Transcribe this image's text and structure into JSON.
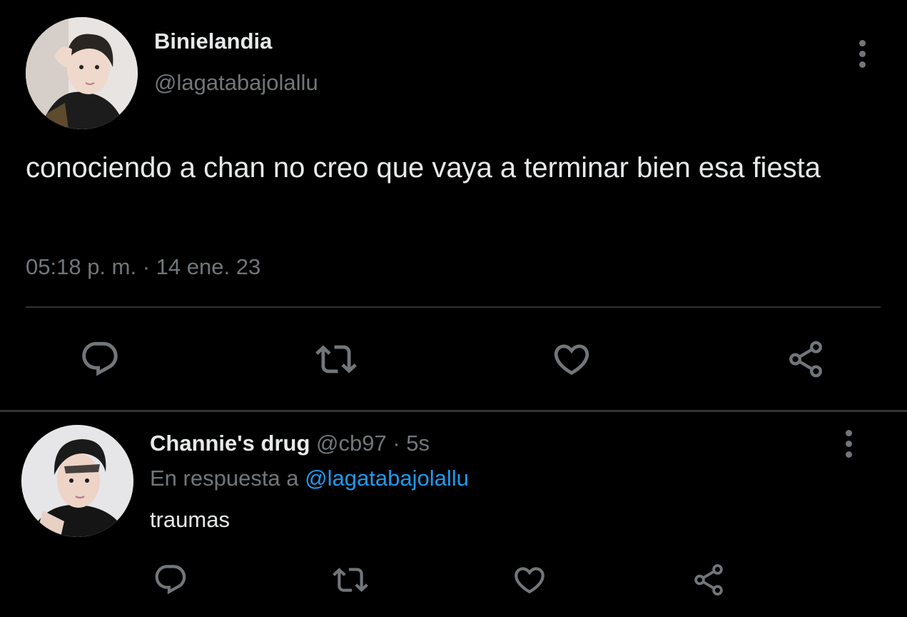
{
  "main_tweet": {
    "author_name": "Binielandia",
    "author_handle": "@lagatabajolallu",
    "text": "conociendo a chan no creo que vaya a terminar bien esa fiesta",
    "time": "05:18 p. m.",
    "separator": "·",
    "date": "14 ene. 23",
    "actions": [
      "reply-icon",
      "retweet-icon",
      "like-icon",
      "share-icon"
    ]
  },
  "reply": {
    "author_name": "Channie's drug",
    "author_handle": "@cb97",
    "separator": "·",
    "time": "5s",
    "replying_prefix": "En respuesta a",
    "replying_to": "@lagatabajolallu",
    "text": "traumas",
    "actions": [
      "reply-icon",
      "retweet-icon",
      "like-icon",
      "share-icon"
    ]
  },
  "colors": {
    "background": "#000000",
    "text": "#e7e9ea",
    "secondary": "#71767b",
    "link": "#1d9bf0",
    "divider": "#2f3336"
  }
}
